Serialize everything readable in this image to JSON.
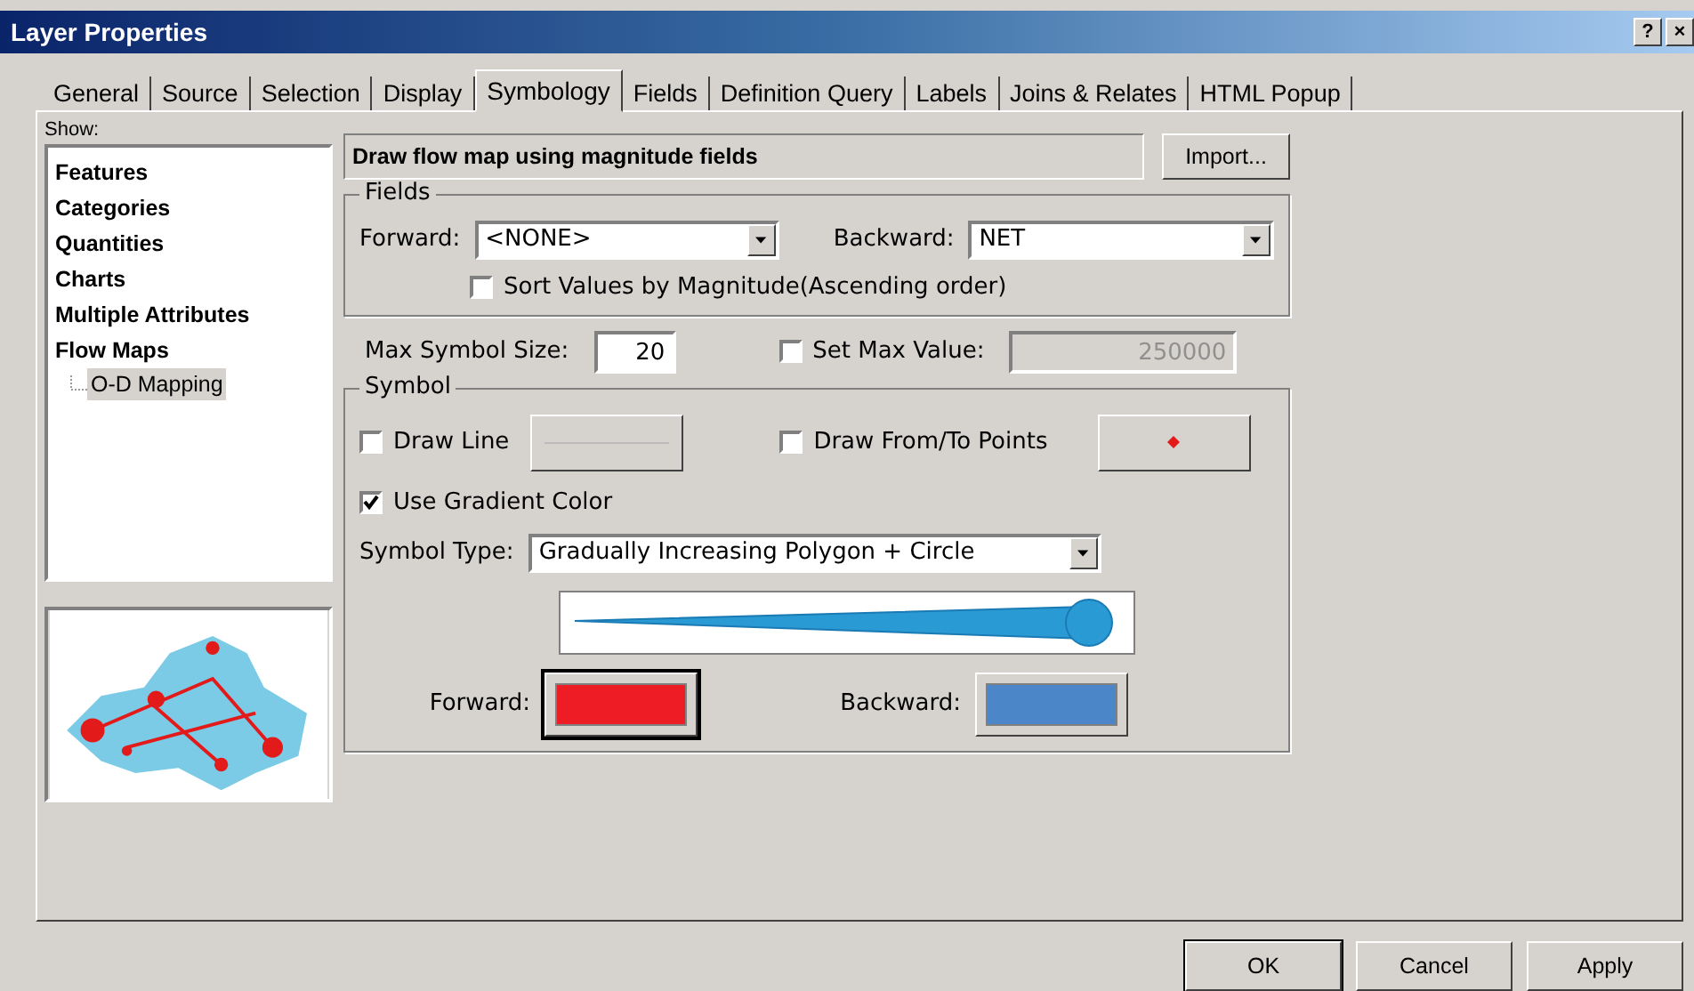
{
  "window": {
    "title": "Layer Properties",
    "controls": [
      "?",
      "×"
    ]
  },
  "tabs": [
    {
      "label": "General",
      "selected": false
    },
    {
      "label": "Source",
      "selected": false
    },
    {
      "label": "Selection",
      "selected": false
    },
    {
      "label": "Display",
      "selected": false
    },
    {
      "label": "Symbology",
      "selected": true
    },
    {
      "label": "Fields",
      "selected": false
    },
    {
      "label": "Definition Query",
      "selected": false
    },
    {
      "label": "Labels",
      "selected": false
    },
    {
      "label": "Joins & Relates",
      "selected": false
    },
    {
      "label": "HTML Popup",
      "selected": false
    }
  ],
  "show": {
    "label": "Show:",
    "items": [
      {
        "label": "Features",
        "selected": false
      },
      {
        "label": "Categories",
        "selected": false
      },
      {
        "label": "Quantities",
        "selected": false
      },
      {
        "label": "Charts",
        "selected": false
      },
      {
        "label": "Multiple Attributes",
        "selected": false
      },
      {
        "label": "Flow Maps",
        "selected": false,
        "children": [
          {
            "label": "O-D Mapping",
            "selected": true
          }
        ]
      }
    ]
  },
  "header": {
    "description": "Draw flow map using magnitude fields",
    "import_button": "Import..."
  },
  "fields": {
    "title": "Fields",
    "forward_label": "Forward:",
    "forward_value": "<NONE>",
    "backward_label": "Backward:",
    "backward_value": "NET",
    "sort": {
      "label": "Sort Values by Magnitude(Ascending order)",
      "checked": false
    }
  },
  "max_symbol_size": {
    "label": "Max Symbol Size:",
    "value": "20"
  },
  "set_max_value": {
    "label": "Set Max Value:",
    "checked": false,
    "value": "250000",
    "disabled": true
  },
  "symbol": {
    "title": "Symbol",
    "draw_line": {
      "label": "Draw Line",
      "checked": false
    },
    "draw_points": {
      "label": "Draw From/To Points",
      "checked": false
    },
    "gradient": {
      "label": "Use Gradient Color",
      "checked": true
    },
    "type_label": "Symbol Type:",
    "type_value": "Gradually Increasing Polygon + Circle",
    "swatches": [
      {
        "label": "Forward:",
        "color": "#ee1c24",
        "selected": true
      },
      {
        "label": "Backward:",
        "color": "#4a86c8",
        "selected": false
      }
    ]
  },
  "buttons": [
    {
      "label": "OK",
      "selected": true
    },
    {
      "label": "Cancel",
      "selected": false
    },
    {
      "label": "Apply",
      "selected": false
    }
  ]
}
